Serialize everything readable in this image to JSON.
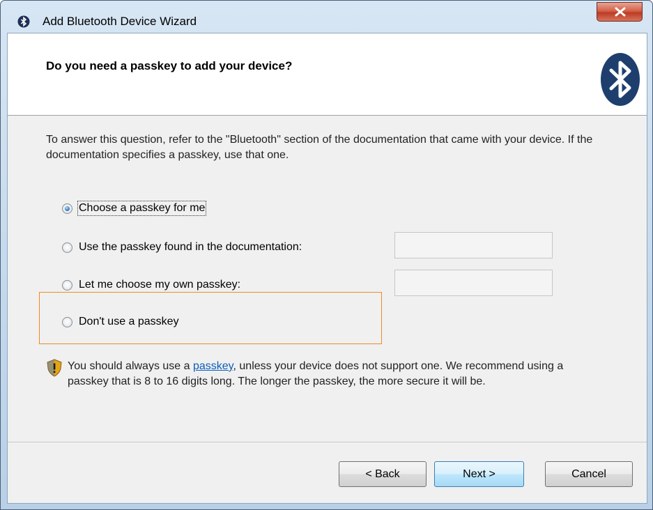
{
  "window": {
    "title": "Add Bluetooth Device Wizard",
    "close_label": "X"
  },
  "header": {
    "title": "Do you need a passkey to add your device?"
  },
  "description": "To answer this question, refer to the \"Bluetooth\" section of the documentation that came with your device. If the documentation specifies a passkey, use that one.",
  "options": [
    {
      "label": "Choose a passkey for me",
      "selected": true
    },
    {
      "label": "Use the passkey found in the documentation:",
      "selected": false,
      "field_value": ""
    },
    {
      "label": "Let me choose my own passkey:",
      "selected": false,
      "field_value": ""
    },
    {
      "label": "Don't use a passkey",
      "selected": false
    }
  ],
  "note": {
    "prefix": "You should always use a ",
    "link": "passkey",
    "suffix": ", unless your device does not support one. We recommend using a passkey that is 8 to 16 digits long. The longer the passkey, the more secure it will be."
  },
  "buttons": {
    "back": "< Back",
    "next": "Next >",
    "cancel": "Cancel"
  },
  "colors": {
    "bluetooth_badge": "#1e3f6e",
    "highlight_border": "#f08a24",
    "close_button": "#c7432b",
    "link": "#0b5dbb"
  },
  "icons": {
    "title": "bluetooth-icon",
    "header": "bluetooth-logo",
    "note": "shield-warning-icon"
  }
}
